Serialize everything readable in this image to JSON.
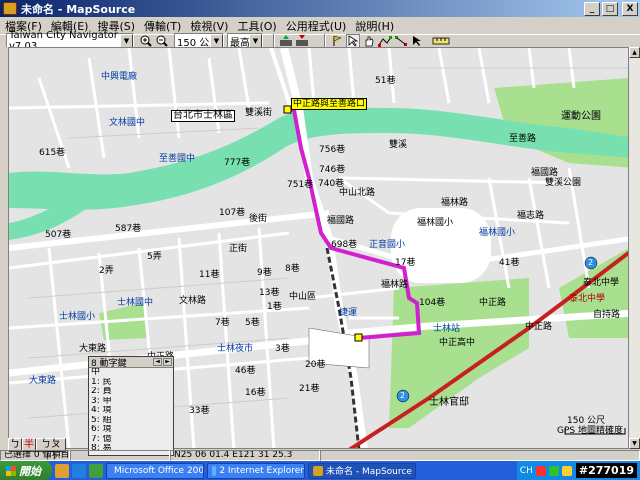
{
  "window": {
    "title": "未命名 - MapSource",
    "minimize_label": "_",
    "maximize_label": "□",
    "close_label": "X"
  },
  "menu": [
    {
      "label": "檔案(F)"
    },
    {
      "label": "編輯(E)"
    },
    {
      "label": "搜尋(S)"
    },
    {
      "label": "傳輸(T)"
    },
    {
      "label": "檢視(V)"
    },
    {
      "label": "工具(O)"
    },
    {
      "label": "公用程式(U)"
    },
    {
      "label": "說明(H)"
    }
  ],
  "toolbar": {
    "map_product": "Taiwan City Navigator v7.03",
    "zoom_scale": "150 公尺",
    "detail_level": "最高"
  },
  "map": {
    "labels": {
      "district": "台北市士林區",
      "destination": "中正路與至善路口",
      "sports_park": "運動公園",
      "shuangxi_park": "雙溪公園",
      "waterway": "雙溪",
      "shuangxi_st": "雙溪街",
      "zhishan_rd": "至善路",
      "fulin_rd": "福林路",
      "fuzhi_rd": "福志路",
      "zhongzheng_rd": "中正路",
      "zhongzheng_rd2": "中正路",
      "zhongshan_n_rd": "中山北路",
      "fulin_elem": "福林國小",
      "shilin_residence": "士林官邸",
      "zhongzheng_hs": "中正高中",
      "lane_756": "756巷",
      "lane_777": "777巷",
      "lane_751": "751巷",
      "lane_740": "740巷",
      "lane_746": "746巷",
      "lane_615": "615巷",
      "lane_507": "507巷",
      "lane_587": "587巷",
      "lane_107": "107巷",
      "lane_698": "698巷",
      "lane_51": "51巷",
      "lane_21": "21巷",
      "lane_17": "17巷",
      "lane_9": "9巷",
      "lane_1": "1巷",
      "lane_13": "13巷",
      "lane_5": "5巷",
      "lane_7": "7巷",
      "lane_11": "11巷",
      "lane_20": "20巷",
      "lane_16": "16巷",
      "lane_46": "46巷",
      "lane_3": "3巷",
      "lane_33": "33巷",
      "lane_8": "8巷",
      "lane_41": "41巷",
      "lane_104": "104巷",
      "back_st": "後街",
      "alley_2": "2弄",
      "alley_5": "5弄",
      "zhengzheng_st": "正街",
      "bus_1": "中興電廠",
      "bus_2": "文林國中",
      "bus_3": "至善國中",
      "bus_4": "福林國小",
      "bus_5": "正音國小",
      "bus_6": "士林國中",
      "bus_7": "士林夜市",
      "bus_8": "士林國小",
      "bus_9": "大東路",
      "bus_10": "士林站",
      "bus_11": "捷運",
      "scale_text": "150 公尺",
      "gps_text": "GPS 地圖精確度",
      "route_2a": "2",
      "route_2b": "2",
      "fuzhong_nb": "福林路",
      "zhongzheng_e": "中正路",
      "ziling_rd": "自持路",
      "taibei_zhong": "泰北中學",
      "taibei_zhong2": "泰北中學",
      "zhongshan_area": "中山區",
      "wenlin_rd": "文林路",
      "dadong_rd": "大東路",
      "fuguo": "福國路",
      "fuguo2": "福國路"
    }
  },
  "search_panel": {
    "header": "8 動字鍵",
    "rows": [
      "中",
      "1: 民",
      "2: 員",
      "3: 申",
      "4: 境",
      "5: 組",
      "6: 境",
      "7: 億",
      "8: 易",
      "9: 鯤"
    ]
  },
  "ime": {
    "key1": "ㄅ",
    "key2": "半",
    "key3": "ㄅㄆㄇ"
  },
  "status": {
    "cell1": "已選擇 0 個項目",
    "cell2": "",
    "coords": "N25 06 01.4 E121 31 25.3",
    "cell4": ""
  },
  "taskbar": {
    "start_label": "開始",
    "tasks": [
      {
        "label": "Microsoft Office 2003 ..."
      },
      {
        "label": "2 Internet Explorer"
      },
      {
        "label": "未命名 - MapSource"
      }
    ],
    "tray_lang": "CH",
    "clock": "#277019"
  },
  "colors": {
    "route": "#d020d0",
    "river": "#78e0b0",
    "major_road": "#ffffff",
    "minor_road": "#ffffff",
    "highway": "#c82020",
    "park": "#a8e090",
    "poi_blue": "#1a4fb0"
  }
}
